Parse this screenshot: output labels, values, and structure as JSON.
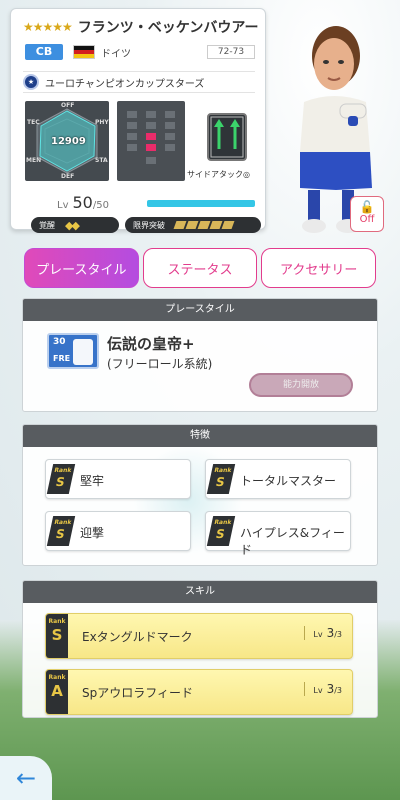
{
  "player": {
    "stars": "★★★★★",
    "name": "フランツ・ベッケンバウアー",
    "position": "CB",
    "country": "ドイツ",
    "years": "72-73",
    "team": "ユーロチャンピオンカップスターズ",
    "total": "12909",
    "stat_labels": [
      "OFF",
      "PHY",
      "STA",
      "DEF",
      "MEN",
      "TEC"
    ],
    "side_attack": "サイドアタック◎",
    "level_label": "Lv",
    "level": "50",
    "level_max": "/50",
    "awaken_label": "覚醒",
    "awaken_marks": "◆◆",
    "limit_label": "限界突破",
    "off_label": "Off"
  },
  "tabs": [
    "プレースタイル",
    "ステータス",
    "アクセサリー"
  ],
  "playstyle": {
    "header": "プレースタイル",
    "icon_number": "30",
    "icon_code": "FRE",
    "title": "伝説の皇帝+",
    "subtitle": "(フリーロール系統)",
    "ability_button": "能力開放"
  },
  "traits": {
    "header": "特徴",
    "rank_text": "Rank",
    "rank": "S",
    "items": [
      "堅牢",
      "トータルマスター",
      "迎撃",
      "ハイプレス&フィード"
    ]
  },
  "skills": {
    "header": "スキル",
    "items": [
      {
        "rank": "S",
        "rank_text": "Rank",
        "name": "Exタングルドマーク",
        "lv_label": "Lv",
        "lv": "3",
        "lv_max": "/3"
      },
      {
        "rank": "A",
        "rank_text": "Rank",
        "name": "Spアウロラフィード",
        "lv_label": "Lv",
        "lv": "3",
        "lv_max": "/3"
      }
    ]
  },
  "colors": {
    "accent_pink": "#e23c8d",
    "position_blue": "#3d8fe0",
    "gold": "#e8c646"
  }
}
